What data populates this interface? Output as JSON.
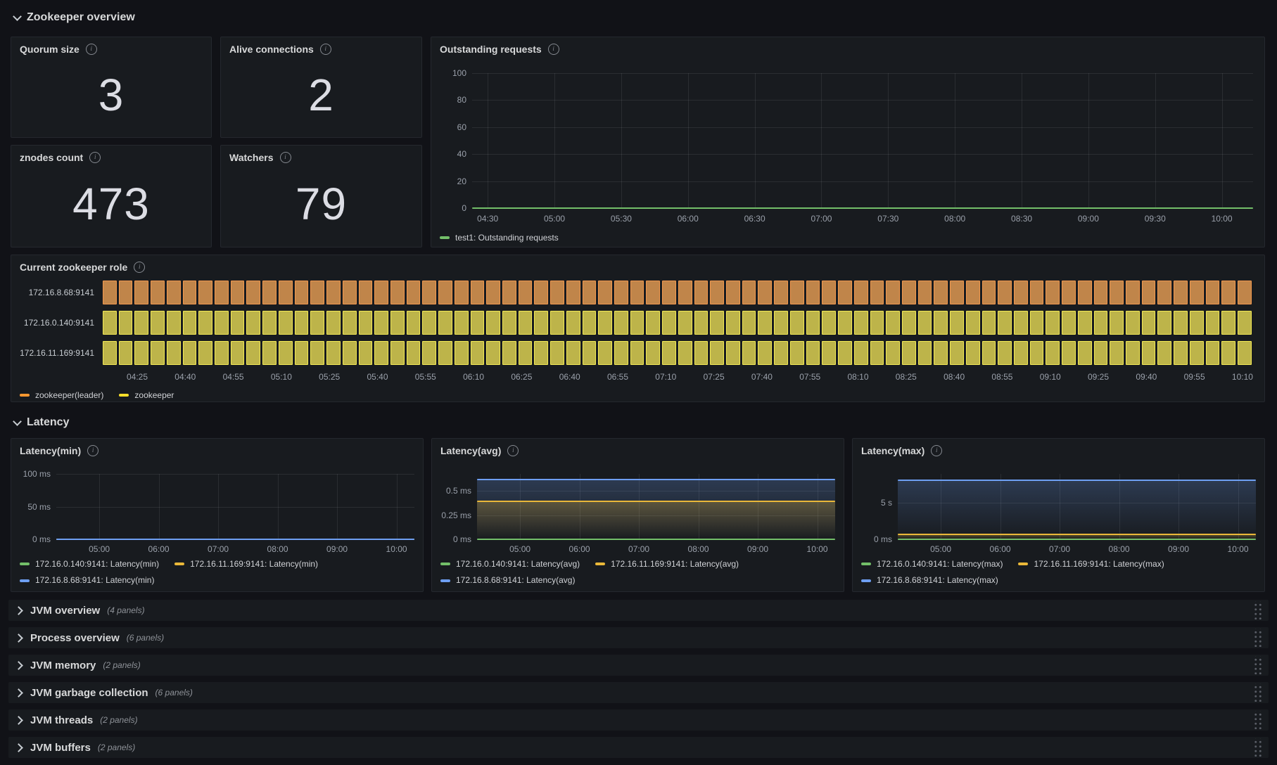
{
  "sections": [
    {
      "title": "Zookeeper overview"
    },
    {
      "title": "Latency"
    }
  ],
  "stats": [
    {
      "title": "Quorum size",
      "value": "3"
    },
    {
      "title": "Alive connections",
      "value": "2"
    },
    {
      "title": "znodes count",
      "value": "473"
    },
    {
      "title": "Watchers",
      "value": "79"
    }
  ],
  "charts": {
    "outstanding": {
      "title": "Outstanding requests",
      "yticks": [
        "100",
        "80",
        "60",
        "40",
        "20",
        "0"
      ],
      "xticks": [
        "04:30",
        "05:00",
        "05:30",
        "06:00",
        "06:30",
        "07:00",
        "07:30",
        "08:00",
        "08:30",
        "09:00",
        "09:30",
        "10:00"
      ],
      "xlead": 2,
      "xtrail": 4,
      "lines": [
        {
          "pct": 100,
          "color": "#73bf69"
        }
      ],
      "legend": [
        {
          "color": "#73bf69",
          "label": "test1: Outstanding requests"
        }
      ]
    },
    "latency_min": {
      "title": "Latency(min)",
      "yticks": [
        "100 ms",
        "50 ms",
        "0 ms"
      ],
      "xticks": [
        "05:00",
        "06:00",
        "07:00",
        "08:00",
        "09:00",
        "10:00"
      ],
      "xlead": 12,
      "xtrail": 5,
      "lines": [
        {
          "pct": 100,
          "color": "#73bf69"
        },
        {
          "pct": 100,
          "color": "#eab839"
        },
        {
          "pct": 100,
          "color": "#6e9ff2"
        }
      ],
      "legend": [
        {
          "color": "#73bf69",
          "label": "172.16.0.140:9141: Latency(min)"
        },
        {
          "color": "#eab839",
          "label": "172.16.11.169:9141: Latency(min)"
        },
        {
          "color": "#6e9ff2",
          "label": "172.16.8.68:9141: Latency(min)"
        }
      ]
    },
    "latency_avg": {
      "title": "Latency(avg)",
      "yticks": [
        "0.5 ms",
        "0.25 ms",
        "0 ms"
      ],
      "ypos": [
        26,
        63,
        100
      ],
      "xticks": [
        "05:00",
        "06:00",
        "07:00",
        "08:00",
        "09:00",
        "10:00"
      ],
      "xlead": 12,
      "xtrail": 5,
      "fills": [
        {
          "from": 8.6,
          "color": "rgba(110,159,242,0.24)"
        },
        {
          "from": 42,
          "color": "rgba(234,184,57,0.28)"
        }
      ],
      "lines": [
        {
          "pct": 100,
          "color": "#73bf69"
        },
        {
          "pct": 42,
          "color": "#eab839"
        },
        {
          "pct": 8.6,
          "color": "#6e9ff2"
        }
      ],
      "legend": [
        {
          "color": "#73bf69",
          "label": "172.16.0.140:9141: Latency(avg)"
        },
        {
          "color": "#eab839",
          "label": "172.16.11.169:9141: Latency(avg)"
        },
        {
          "color": "#6e9ff2",
          "label": "172.16.8.68:9141: Latency(avg)"
        }
      ]
    },
    "latency_max": {
      "title": "Latency(max)",
      "yticks": [
        "5 s",
        "0 ms"
      ],
      "ypos": [
        44,
        100
      ],
      "xticks": [
        "05:00",
        "06:00",
        "07:00",
        "08:00",
        "09:00",
        "10:00"
      ],
      "xlead": 12,
      "xtrail": 5,
      "fills": [
        {
          "from": 9.6,
          "color": "rgba(110,159,242,0.24)"
        },
        {
          "from": 92.5,
          "color": "rgba(234,184,57,0.3)"
        }
      ],
      "lines": [
        {
          "pct": 100,
          "color": "#73bf69"
        },
        {
          "pct": 92.5,
          "color": "#eab839"
        },
        {
          "pct": 9.6,
          "color": "#6e9ff2"
        }
      ],
      "legend": [
        {
          "color": "#73bf69",
          "label": "172.16.0.140:9141: Latency(max)"
        },
        {
          "color": "#eab839",
          "label": "172.16.11.169:9141: Latency(max)"
        },
        {
          "color": "#6e9ff2",
          "label": "172.16.8.68:9141: Latency(max)"
        }
      ]
    }
  },
  "role": {
    "title": "Current zookeeper role",
    "blocks": 72,
    "rows": [
      {
        "label": "172.16.8.68:9141",
        "state": "zookeeper(leader)",
        "fill": "#c0854a",
        "border": "#f2994f"
      },
      {
        "label": "172.16.0.140:9141",
        "state": "zookeeper",
        "fill": "#bdb44a",
        "border": "#f3e955"
      },
      {
        "label": "172.16.11.169:9141",
        "state": "zookeeper",
        "fill": "#bdb44a",
        "border": "#f3e955"
      }
    ],
    "xticks": [
      "04:25",
      "04:40",
      "04:55",
      "05:10",
      "05:25",
      "05:40",
      "05:55",
      "06:10",
      "06:25",
      "06:40",
      "06:55",
      "07:10",
      "07:25",
      "07:40",
      "07:55",
      "08:10",
      "08:25",
      "08:40",
      "08:55",
      "09:10",
      "09:25",
      "09:40",
      "09:55",
      "10:10"
    ],
    "xlead": 3,
    "xtrail": 0.8,
    "legend": [
      {
        "color": "#ff9830",
        "label": "zookeeper(leader)"
      },
      {
        "color": "#fade2a",
        "label": "zookeeper"
      }
    ]
  },
  "collapsed_rows": [
    {
      "title": "JVM overview",
      "count": "(4 panels)"
    },
    {
      "title": "Process overview",
      "count": "(6 panels)"
    },
    {
      "title": "JVM memory",
      "count": "(2 panels)"
    },
    {
      "title": "JVM garbage collection",
      "count": "(6 panels)"
    },
    {
      "title": "JVM threads",
      "count": "(2 panels)"
    },
    {
      "title": "JVM buffers",
      "count": "(2 panels)"
    }
  ],
  "chart_data": [
    {
      "type": "stat",
      "title": "Quorum size",
      "value": 3
    },
    {
      "type": "stat",
      "title": "Alive connections",
      "value": 2
    },
    {
      "type": "stat",
      "title": "znodes count",
      "value": 473
    },
    {
      "type": "stat",
      "title": "Watchers",
      "value": 79
    },
    {
      "type": "line",
      "title": "Outstanding requests",
      "ylabel": "",
      "ylim": [
        0,
        100
      ],
      "x_range": [
        "04:30",
        "10:00"
      ],
      "grid": true,
      "legend_position": "bottom",
      "series": [
        {
          "name": "test1: Outstanding requests",
          "constant_value": 0
        }
      ]
    },
    {
      "type": "state-timeline",
      "title": "Current zookeeper role",
      "x_range": [
        "04:25",
        "10:10"
      ],
      "rows": [
        {
          "instance": "172.16.8.68:9141",
          "state": "zookeeper(leader)"
        },
        {
          "instance": "172.16.0.140:9141",
          "state": "zookeeper"
        },
        {
          "instance": "172.16.11.169:9141",
          "state": "zookeeper"
        }
      ],
      "states": [
        {
          "name": "zookeeper(leader)",
          "color": "#ff9830"
        },
        {
          "name": "zookeeper",
          "color": "#fade2a"
        }
      ]
    },
    {
      "type": "line",
      "title": "Latency(min)",
      "unit": "ms",
      "ylim": [
        0,
        100
      ],
      "x_range": [
        "05:00",
        "10:00"
      ],
      "series": [
        {
          "name": "172.16.0.140:9141: Latency(min)",
          "constant_value": 0
        },
        {
          "name": "172.16.11.169:9141: Latency(min)",
          "constant_value": 0
        },
        {
          "name": "172.16.8.68:9141: Latency(min)",
          "constant_value": 0
        }
      ]
    },
    {
      "type": "line",
      "title": "Latency(avg)",
      "unit": "ms",
      "ylim": [
        0,
        0.68
      ],
      "x_range": [
        "05:00",
        "10:00"
      ],
      "series": [
        {
          "name": "172.16.0.140:9141: Latency(avg)",
          "constant_value": 0
        },
        {
          "name": "172.16.11.169:9141: Latency(avg)",
          "constant_value": 0.4
        },
        {
          "name": "172.16.8.68:9141: Latency(avg)",
          "constant_value": 0.62
        }
      ]
    },
    {
      "type": "line",
      "title": "Latency(max)",
      "unit": "s",
      "ylim": [
        0,
        9
      ],
      "x_range": [
        "05:00",
        "10:00"
      ],
      "series": [
        {
          "name": "172.16.0.140:9141: Latency(max)",
          "constant_value": 0
        },
        {
          "name": "172.16.11.169:9141: Latency(max)",
          "constant_value": 0.6
        },
        {
          "name": "172.16.8.68:9141: Latency(max)",
          "constant_value": 8
        }
      ]
    }
  ]
}
